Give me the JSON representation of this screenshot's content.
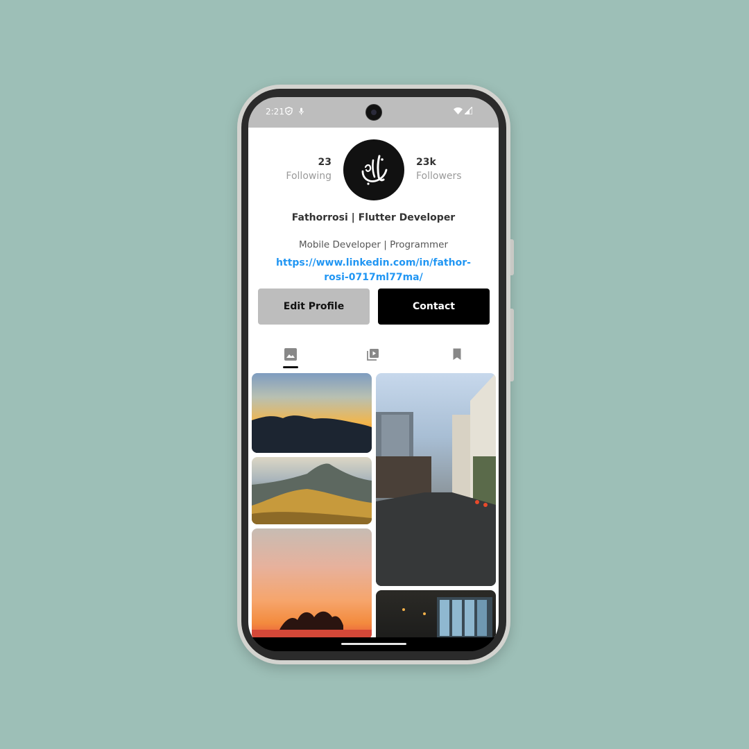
{
  "status_bar": {
    "time": "2:21",
    "icons": [
      "shield-icon",
      "mic-icon",
      "wifi-icon",
      "signal-icon"
    ]
  },
  "profile": {
    "following_count": "23",
    "following_label": "Following",
    "followers_count": "23k",
    "followers_label": "Followers",
    "name": "Fathorrosi | Flutter Developer",
    "bio": "Mobile Developer | Programmer",
    "link": "https://www.linkedin.com/in/fathor-rosi-0717ml77ma/"
  },
  "actions": {
    "edit_label": "Edit Profile",
    "contact_label": "Contact"
  },
  "tabs": [
    {
      "icon": "image-icon",
      "selected": true
    },
    {
      "icon": "video-library-icon",
      "selected": false
    },
    {
      "icon": "bookmark-icon",
      "selected": false
    }
  ],
  "gallery": {
    "photos": [
      "sunset-mountains",
      "mountain-hills",
      "sunset-trees",
      "city-street",
      "night-restaurant"
    ]
  },
  "colors": {
    "background": "#9dbfb7",
    "link": "#2196f3",
    "edit_button": "#bdbdbd",
    "contact_button": "#000000"
  }
}
